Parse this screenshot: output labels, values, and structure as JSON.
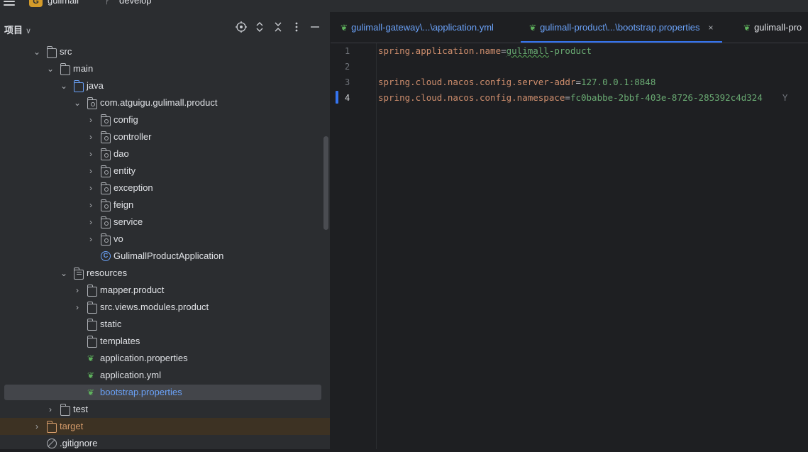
{
  "topbar": {
    "project_badge": "G",
    "project_name": "gulimall",
    "branch_name": "develop"
  },
  "panel": {
    "title": "项目",
    "title_chevron": "∨"
  },
  "tree": [
    {
      "label": "src",
      "expanded": true,
      "icon": "folder-icon"
    },
    {
      "label": "main",
      "expanded": true,
      "icon": "folder-icon"
    },
    {
      "label": "java",
      "expanded": true,
      "icon": "source-folder-icon"
    },
    {
      "label": "com.atguigu.gulimall.product",
      "expanded": true,
      "icon": "package-icon"
    },
    {
      "label": "config",
      "expanded": false,
      "icon": "package-icon"
    },
    {
      "label": "controller",
      "expanded": false,
      "icon": "package-icon"
    },
    {
      "label": "dao",
      "expanded": false,
      "icon": "package-icon"
    },
    {
      "label": "entity",
      "expanded": false,
      "icon": "package-icon"
    },
    {
      "label": "exception",
      "expanded": false,
      "icon": "package-icon"
    },
    {
      "label": "feign",
      "expanded": false,
      "icon": "package-icon"
    },
    {
      "label": "service",
      "expanded": false,
      "icon": "package-icon"
    },
    {
      "label": "vo",
      "expanded": false,
      "icon": "package-icon"
    },
    {
      "label": "GulimallProductApplication",
      "icon": "spring-class-icon"
    },
    {
      "label": "resources",
      "expanded": true,
      "icon": "resources-folder-icon"
    },
    {
      "label": "mapper.product",
      "expanded": false,
      "icon": "folder-icon"
    },
    {
      "label": "src.views.modules.product",
      "expanded": false,
      "icon": "folder-icon"
    },
    {
      "label": "static",
      "icon": "folder-icon"
    },
    {
      "label": "templates",
      "icon": "folder-icon"
    },
    {
      "label": "application.properties",
      "icon": "spring-config-icon"
    },
    {
      "label": "application.yml",
      "icon": "spring-config-icon"
    },
    {
      "label": "bootstrap.properties",
      "icon": "spring-config-icon",
      "selected": true
    },
    {
      "label": "test",
      "expanded": false,
      "icon": "folder-icon"
    },
    {
      "label": "target",
      "expanded": false,
      "icon": "excluded-folder-icon"
    },
    {
      "label": ".gitignore",
      "icon": "ignore-file-icon"
    }
  ],
  "tabs": [
    {
      "label": "gulimall-gateway\\...\\application.yml",
      "icon": "spring-config-icon"
    },
    {
      "label": "gulimall-product\\...\\bootstrap.properties",
      "icon": "spring-config-icon",
      "active": true,
      "close": "×"
    },
    {
      "label": "gulimall-pro",
      "icon": "spring-config-icon"
    }
  ],
  "editor": {
    "line_numbers": [
      "1",
      "2",
      "3",
      "4"
    ],
    "lines": [
      {
        "key": "spring.application.name",
        "eq": "=",
        "value_a": "gulimall",
        "value_b": "-product"
      },
      {
        "key": "",
        "eq": "",
        "value_a": "",
        "value_b": ""
      },
      {
        "key": "spring.cloud.nacos.config.server-addr",
        "eq": "=",
        "value_a": "127.0.0.1:8848",
        "value_b": ""
      },
      {
        "key": "spring.cloud.nacos.config.namespace",
        "eq": "=",
        "value_a": "fc0babbe-2bbf-403e-8726-285392c4d324",
        "value_b": ""
      }
    ],
    "hint": "Y"
  },
  "colors": {
    "accent": "#3574f0",
    "key": "#cf8e6d",
    "value": "#6aab73",
    "excluded": "#d49b6a"
  }
}
